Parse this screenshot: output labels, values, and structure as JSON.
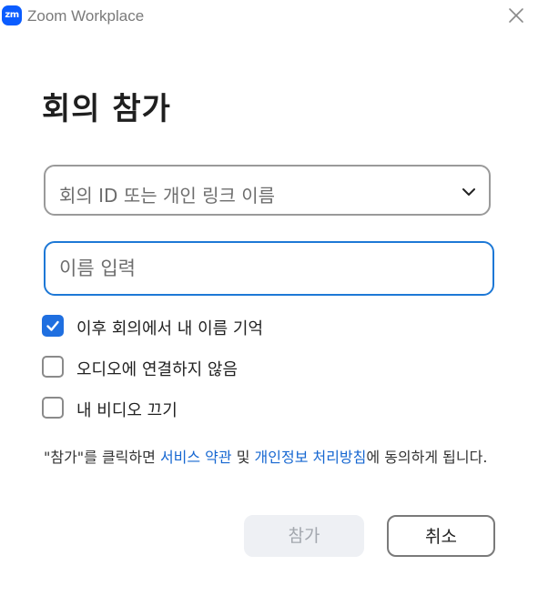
{
  "window": {
    "app_logo": "zm",
    "title": "Zoom Workplace",
    "close_icon": "close-icon"
  },
  "page": {
    "title": "회의 참가"
  },
  "meeting_id_select": {
    "placeholder": "회의 ID 또는 개인 링크 이름",
    "icon": "chevron-down-icon"
  },
  "name_input": {
    "placeholder": "이름 입력",
    "value": ""
  },
  "options": [
    {
      "label": "이후 회의에서 내 이름 기억",
      "checked": true
    },
    {
      "label": "오디오에 연결하지 않음",
      "checked": false
    },
    {
      "label": "내 비디오 끄기",
      "checked": false
    }
  ],
  "notice": {
    "prefix": "\"참가\"를 클릭하면 ",
    "terms_link": "서비스 약관",
    "middle": " 및 ",
    "privacy_link": "개인정보 처리방침",
    "suffix": "에 동의하게 됩니다."
  },
  "buttons": {
    "join_label": "참가",
    "cancel_label": "취소"
  },
  "colors": {
    "accent": "#1f6fe0",
    "link": "#1667d1",
    "input_focus_border": "#1d78d6",
    "disabled_button_bg": "#eef0f4",
    "disabled_button_text": "#a3a7ae"
  }
}
